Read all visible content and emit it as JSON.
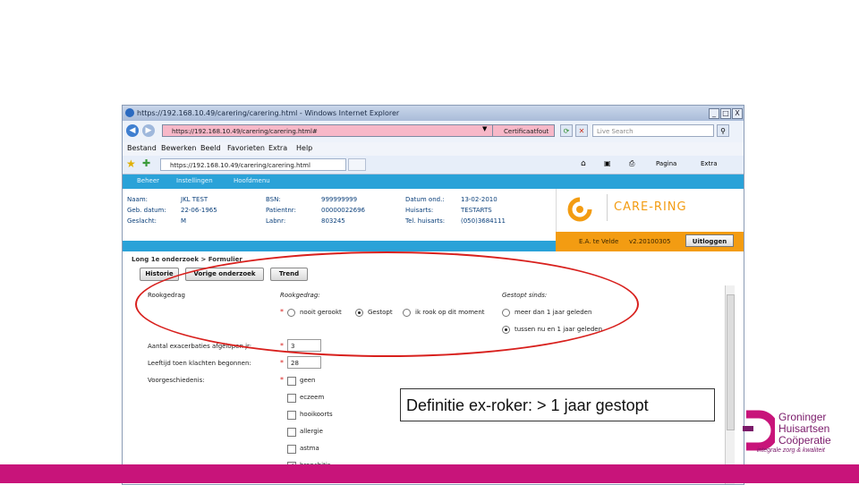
{
  "window": {
    "title": "https://192.168.10.49/carering/carering.html - Windows Internet Explorer",
    "controls": [
      "_",
      "□",
      "X"
    ]
  },
  "addressbar": {
    "url": "https://192.168.10.49/carering/carering.html#",
    "cert_label": "Certificaatfout",
    "search_placeholder": "Live Search"
  },
  "menu": [
    "Bestand",
    "Bewerken",
    "Beeld",
    "Favorieten",
    "Extra",
    "Help"
  ],
  "favorites": {
    "tab_url": "https://192.168.10.49/carering/carering.html",
    "tools": [
      "Pagina",
      "Extra"
    ]
  },
  "app_nav": [
    "Beheer",
    "Instellingen",
    "Hoofdmenu"
  ],
  "patient": {
    "naam_label": "Naam:",
    "naam": "JKL TEST",
    "geb_label": "Geb. datum:",
    "geb": "22-06-1965",
    "geslacht_label": "Geslacht:",
    "geslacht": "M",
    "bsn_label": "BSN:",
    "bsn": "999999999",
    "patientnr_label": "Patientnr:",
    "patientnr": "00000022696",
    "labnr_label": "Labnr:",
    "labnr": "803245",
    "datum_label": "Datum ond.:",
    "datum": "13-02-2010",
    "huisarts_label": "Huisarts:",
    "huisarts": "TESTARTS",
    "tel_label": "Tel. huisarts:",
    "tel": "(050)3684111"
  },
  "brand": {
    "name": "CARE-RING",
    "user": "E.A. te Velde",
    "version": "v2.20100305",
    "logout": "Uitloggen"
  },
  "form": {
    "breadcrumb": "Long 1e onderzoek > Formulier",
    "buttons": [
      "Historie",
      "Vorige onderzoek",
      "Trend"
    ],
    "rookgedrag_section": "Rookgedrag",
    "rookgedrag_title": "Rookgedrag:",
    "gestopt_title": "Gestopt sinds:",
    "rook_options": [
      "nooit gerookt",
      "Gestopt",
      "ik rook op dit moment"
    ],
    "rook_selected": 1,
    "sinds_options": [
      "meer dan 1 jaar geleden",
      "tussen nu en 1 jaar geleden"
    ],
    "sinds_selected": 1,
    "exacerbaties_label": "Aantal exacerbaties afgelopen jr:",
    "exacerbaties_value": "3",
    "leeftijd_label": "Leeftijd toen klachten begonnen:",
    "leeftijd_value": "28",
    "voorgeschiedenis_label": "Voorgeschiedenis:",
    "voorgeschiedenis": [
      {
        "label": "geen",
        "checked": false
      },
      {
        "label": "eczeem",
        "checked": false
      },
      {
        "label": "hooikoorts",
        "checked": false
      },
      {
        "label": "allergie",
        "checked": false
      },
      {
        "label": "astma",
        "checked": false
      },
      {
        "label": "bronchitis",
        "checked": true
      }
    ]
  },
  "callout": "Definitie ex-roker: > 1 jaar gestopt",
  "org": {
    "line1": "Groninger",
    "line2": "Huisartsen",
    "line3": "Coöperatie",
    "tagline": "integrale zorg & kwaliteit"
  },
  "colors": {
    "accent_blue": "#2aa2d8",
    "brand_orange": "#f39c12",
    "highlight_red": "#d8201d",
    "org_magenta": "#c8147a"
  }
}
